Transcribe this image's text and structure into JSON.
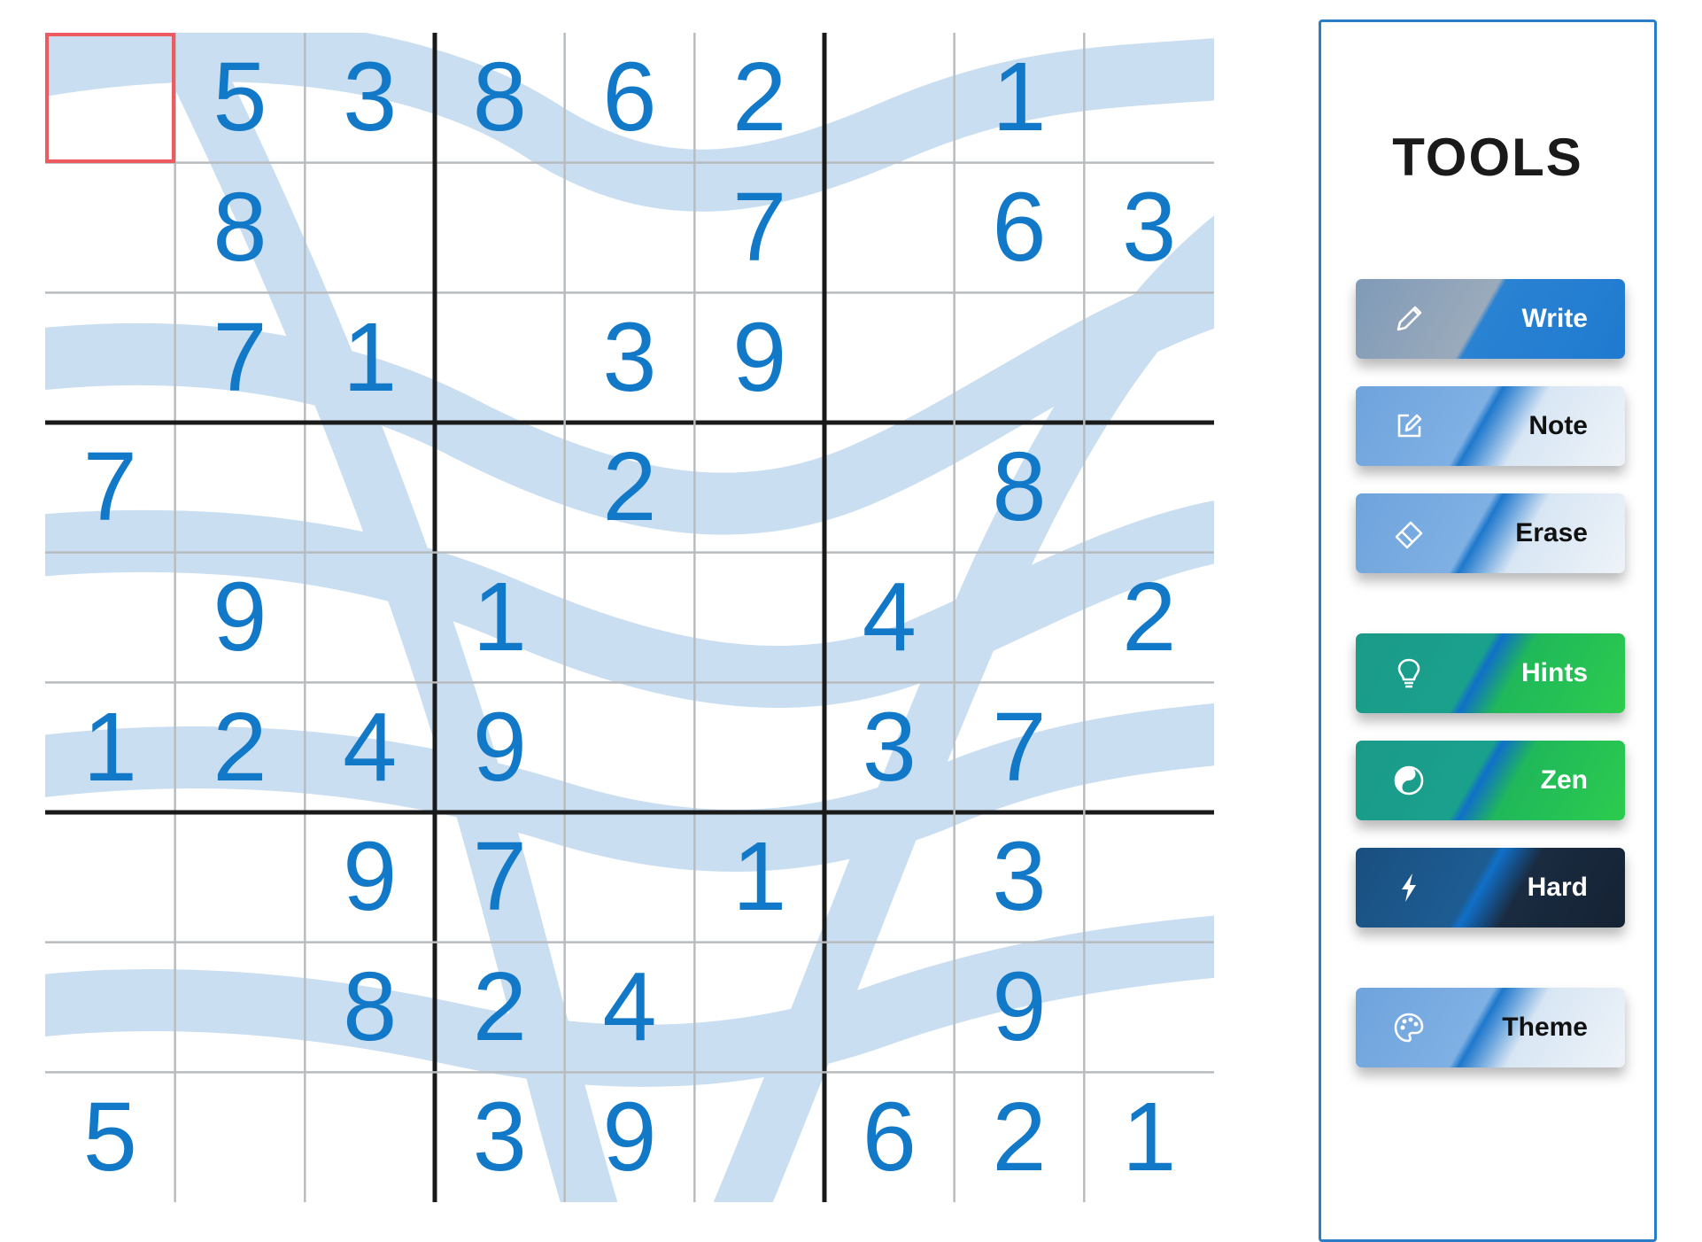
{
  "board": {
    "cells": [
      [
        "",
        "5",
        "3",
        "8",
        "6",
        "2",
        "",
        "1",
        ""
      ],
      [
        "",
        "8",
        "",
        "",
        "",
        "7",
        "",
        "6",
        "3"
      ],
      [
        "",
        "7",
        "1",
        "",
        "3",
        "9",
        "",
        "",
        ""
      ],
      [
        "7",
        "",
        "",
        "",
        "2",
        "",
        "",
        "8",
        ""
      ],
      [
        "",
        "9",
        "",
        "1",
        "",
        "",
        "4",
        "",
        "2"
      ],
      [
        "1",
        "2",
        "4",
        "9",
        "",
        "",
        "3",
        "7",
        ""
      ],
      [
        "",
        "",
        "9",
        "7",
        "",
        "1",
        "",
        "3",
        ""
      ],
      [
        "",
        "",
        "8",
        "2",
        "4",
        "",
        "",
        "9",
        ""
      ],
      [
        "5",
        "",
        "",
        "3",
        "9",
        "",
        "6",
        "2",
        "1"
      ]
    ],
    "selected": {
      "row": 0,
      "col": 0
    },
    "colors": {
      "digit": "#1278c8",
      "thin_line": "#b8bcbf",
      "thick_line": "#1a1a1a",
      "wave": "#c9def0",
      "selection": "#ee5a62"
    }
  },
  "tools": {
    "title": "TOOLS",
    "border_color": "#2a7cc6",
    "buttons": [
      {
        "id": "write",
        "label": "Write",
        "icon": "pencil-icon",
        "style": "active"
      },
      {
        "id": "note",
        "label": "Note",
        "icon": "note-edit-icon",
        "style": "light"
      },
      {
        "id": "erase",
        "label": "Erase",
        "icon": "eraser-icon",
        "style": "light"
      },
      {
        "id": "hints",
        "label": "Hints",
        "icon": "lightbulb-icon",
        "style": "green"
      },
      {
        "id": "zen",
        "label": "Zen",
        "icon": "yin-yang-icon",
        "style": "green"
      },
      {
        "id": "hard",
        "label": "Hard",
        "icon": "lightning-icon",
        "style": "dark"
      },
      {
        "id": "theme",
        "label": "Theme",
        "icon": "palette-icon",
        "style": "light"
      }
    ]
  }
}
